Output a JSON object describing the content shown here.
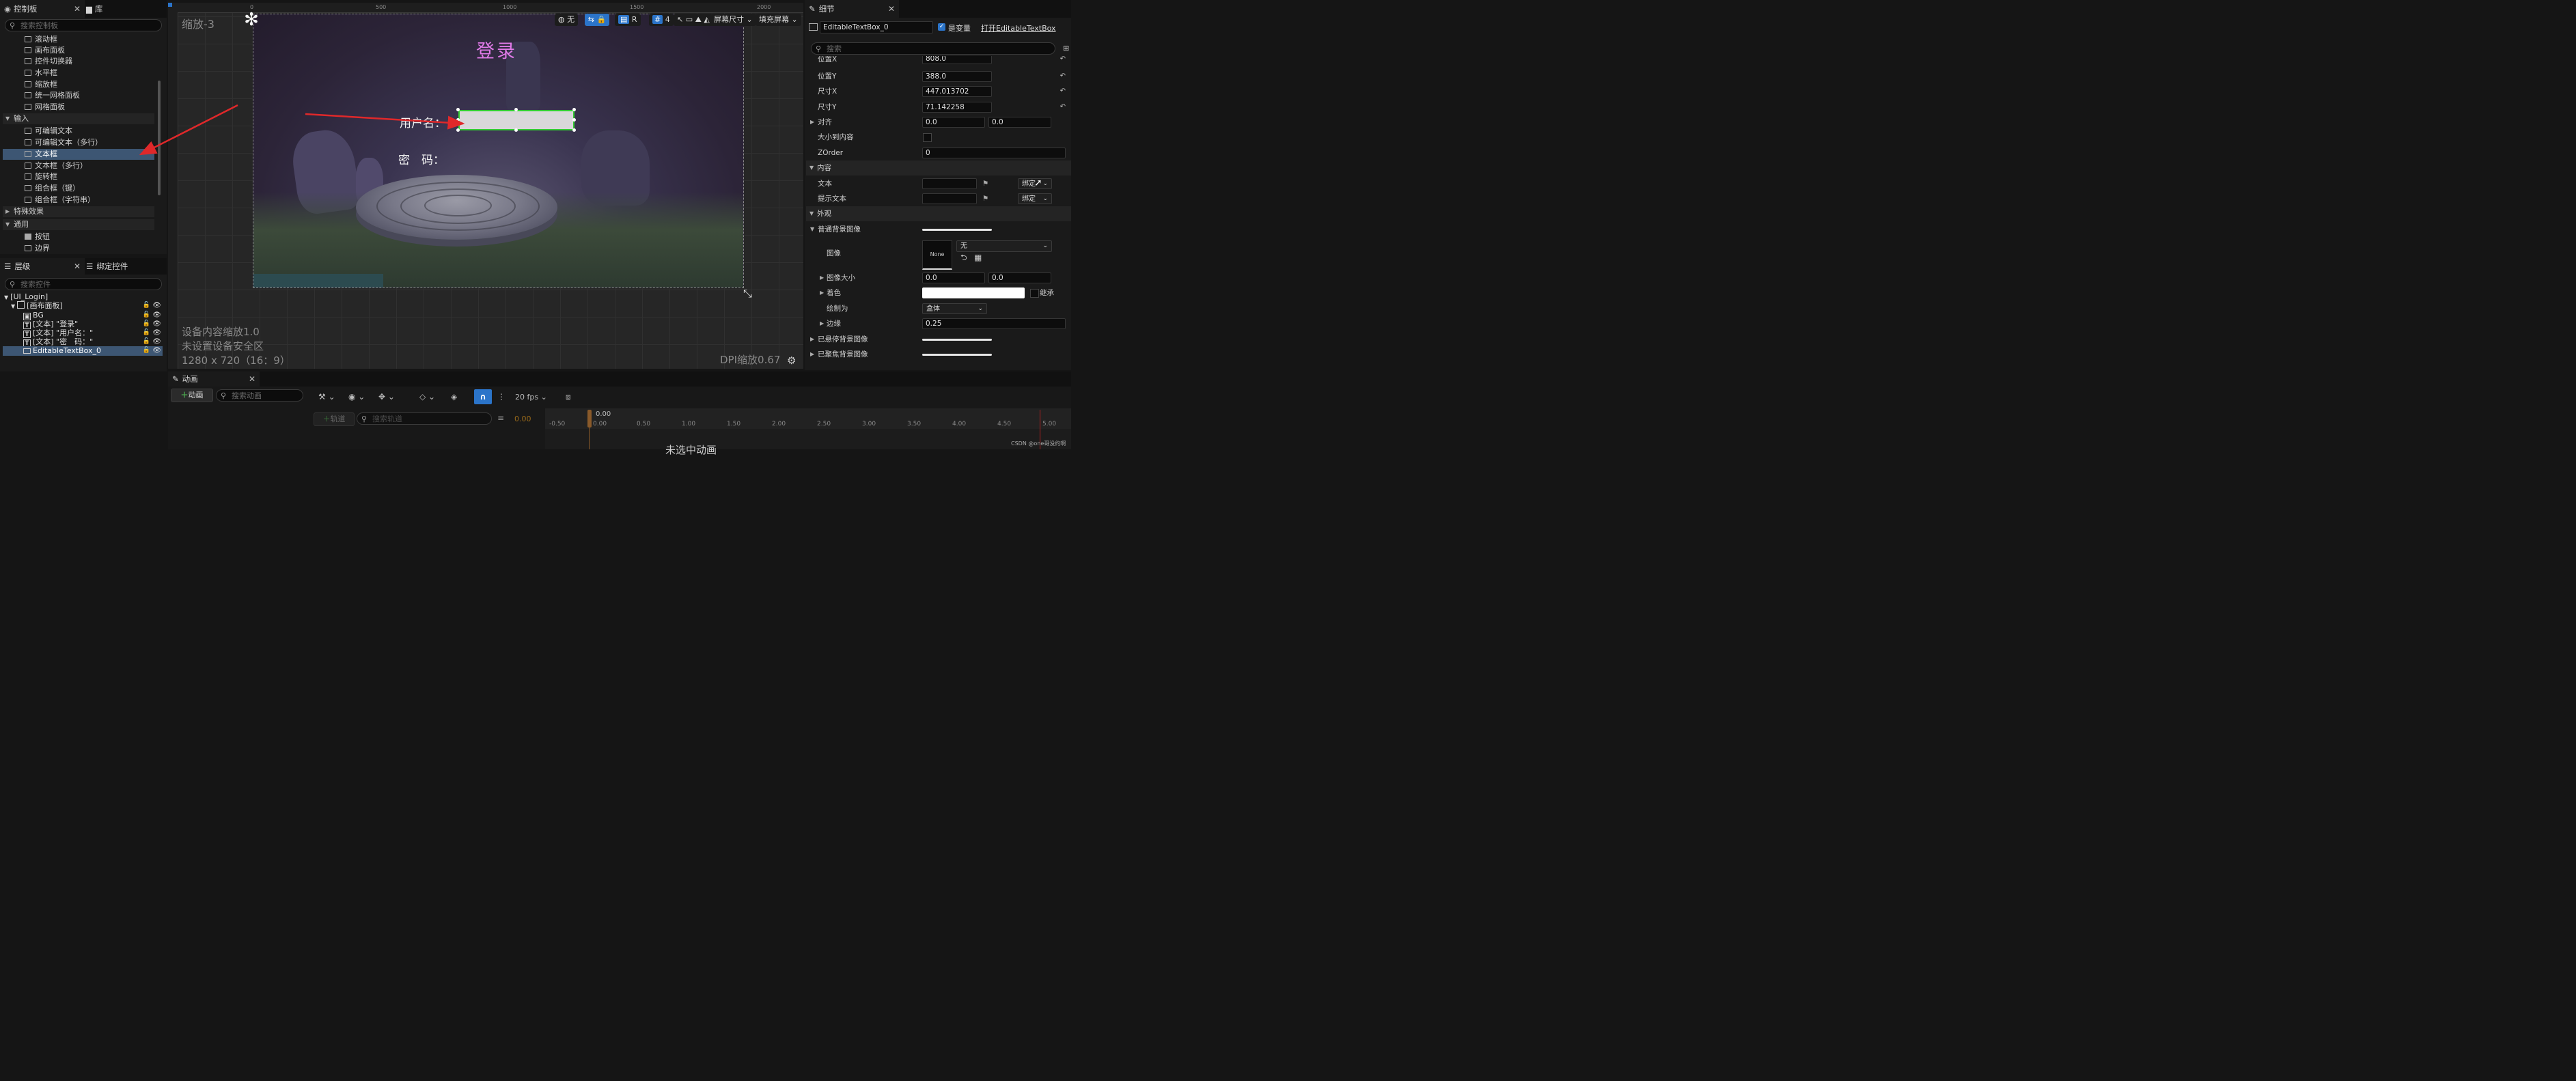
{
  "palette": {
    "tab_label": "控制板",
    "library_tab_label": "库",
    "search_placeholder": "搜索控制板",
    "items_top": [
      "滚动框",
      "画布面板",
      "控件切换器",
      "水平框",
      "缩放框",
      "统一网格面板",
      "网格面板"
    ],
    "category_input": "输入",
    "items_input": [
      "可编辑文本",
      "可编辑文本（多行）",
      "文本框",
      "文本框（多行）",
      "旋转框",
      "组合框（键）",
      "组合框（字符串）"
    ],
    "category_special": "特殊效果",
    "category_common": "通用",
    "items_common": [
      "按钮",
      "边界"
    ]
  },
  "hierarchy": {
    "tab_label": "层级",
    "bind_tab_label": "绑定控件",
    "search_placeholder": "搜索控件",
    "root": "[UI_Login]",
    "canvas": "[画布面板]",
    "bg": "BG",
    "title": "[文本] \"登录\"",
    "username": "[文本] \"用户名：\"",
    "password": "[文本] \"密　码：\"",
    "textbox": "EditableTextBox_0"
  },
  "viewport": {
    "zoom_label": "缩放-3",
    "ruler_ticks": [
      "0",
      "500",
      "1000",
      "1500",
      "2000"
    ],
    "none_label": "无",
    "r_label": "R",
    "grid_num": "4",
    "screen_size_label": "屏幕尺寸",
    "fill_screen_label": "填充屏幕",
    "title_text": "登录",
    "username_label": "用户名：",
    "password_label": "密　码：",
    "info_line1": "设备内容缩放1.0",
    "info_line2": "未设置设备安全区",
    "info_line3": "1280 x 720（16：9）",
    "dpi_label": "DPI缩放0.67"
  },
  "details": {
    "tab_label": "细节",
    "widget_name": "EditableTextBox_0",
    "is_variable_label": "是变量",
    "open_link": "打开EditableTextBox",
    "search_placeholder": "搜索",
    "pos_x_label": "位置X",
    "pos_x_value": "808.0",
    "pos_y_label": "位置Y",
    "pos_y_value": "388.0",
    "size_x_label": "尺寸X",
    "size_x_value": "447.013702",
    "size_y_label": "尺寸Y",
    "size_y_value": "71.142258",
    "align_label": "对齐",
    "align_x": "0.0",
    "align_y": "0.0",
    "size_to_content_label": "大小到内容",
    "zorder_label": "ZOrder",
    "zorder_value": "0",
    "content_section": "内容",
    "text_label": "文本",
    "bind_label": "绑定",
    "hint_text_label": "提示文本",
    "appearance_section": "外观",
    "normal_bg_label": "普通背景图像",
    "image_label": "图像",
    "image_thumb": "None",
    "image_value": "无",
    "image_size_label": "图像大小",
    "image_size_x": "0.0",
    "image_size_y": "0.0",
    "tint_label": "着色",
    "inherit_label": "继承",
    "draw_as_label": "绘制为",
    "draw_as_value": "盒体",
    "margin_label": "边缘",
    "margin_value": "0.25",
    "hovered_bg_label": "已悬停背景图像",
    "focused_bg_label": "已聚焦背景图像"
  },
  "animation": {
    "tab_label": "动画",
    "add_anim_label": "动画",
    "search_anim_placeholder": "搜索动画",
    "track_label": "轨道",
    "search_track_placeholder": "搜索轨道",
    "fps_label": "20 fps",
    "current_time": "0.00",
    "playhead_time": "0.00",
    "time_ticks": [
      "-0.50",
      "0.00",
      "0.50",
      "1.00",
      "1.50",
      "2.00",
      "2.50",
      "3.00",
      "3.50",
      "4.00",
      "4.50",
      "5.00"
    ],
    "no_anim_text": "未选中动画"
  },
  "watermark": "CSDN @one哥没约啊",
  "colors": {
    "accent_blue": "#2b74c9",
    "selection": "#3d5673",
    "title_pink": "#e07ae8",
    "textbox_border": "#33cc33",
    "arrow_red": "#e0282a"
  }
}
